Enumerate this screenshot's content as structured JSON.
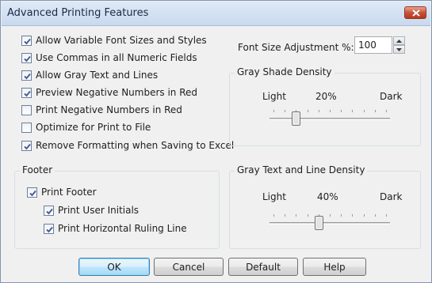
{
  "dialog": {
    "title": "Advanced Printing Features",
    "close_icon": "close-x-icon"
  },
  "options": [
    {
      "label": "Allow Variable Font Sizes and Styles",
      "checked": true
    },
    {
      "label": "Use Commas in all Numeric Fields",
      "checked": true
    },
    {
      "label": "Allow Gray Text and Lines",
      "checked": true
    },
    {
      "label": "Preview Negative Numbers in Red",
      "checked": true
    },
    {
      "label": "Print Negative Numbers in Red",
      "checked": false
    },
    {
      "label": "Optimize for Print to File",
      "checked": false
    },
    {
      "label": "Remove Formatting when Saving to Excel",
      "checked": true
    }
  ],
  "font_size": {
    "label": "Font Size Adjustment %:",
    "value": "100"
  },
  "gray_shade": {
    "legend": "Gray Shade Density",
    "light": "Light",
    "value_text": "20%",
    "dark": "Dark",
    "level": 0.2
  },
  "gray_text": {
    "legend": "Gray Text and Line Density",
    "light": "Light",
    "value_text": "40%",
    "dark": "Dark",
    "level": 0.4
  },
  "footer": {
    "legend": "Footer",
    "print_footer": {
      "label": "Print Footer",
      "checked": true
    },
    "print_user_initials": {
      "label": "Print User Initials",
      "checked": true
    },
    "print_ruling_line": {
      "label": "Print Horizontal Ruling Line",
      "checked": true
    }
  },
  "buttons": {
    "ok": "OK",
    "cancel": "Cancel",
    "default": "Default",
    "help": "Help"
  },
  "colors": {
    "check_mark": "#4a5f97",
    "close_button": "#c9523a",
    "default_button_border": "#3c7fb1"
  }
}
